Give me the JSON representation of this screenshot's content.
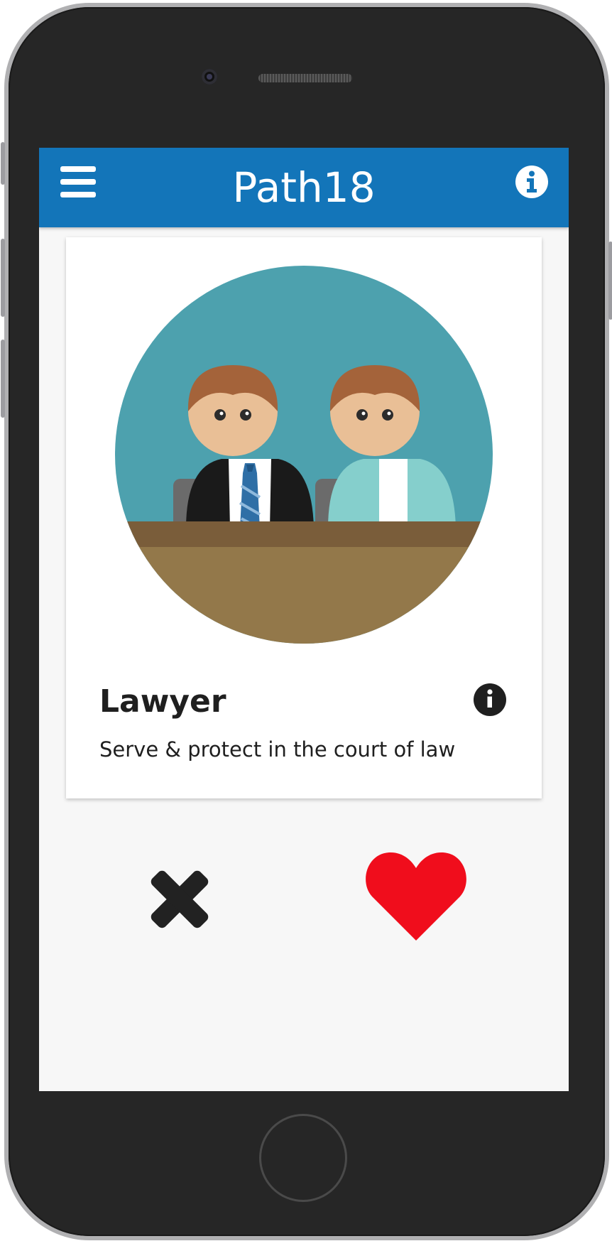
{
  "app": {
    "title": "Path18"
  },
  "card": {
    "title": "Lawyer",
    "description": "Serve & protect in the court of law",
    "image": "two-lawyers-at-desk-illustration"
  },
  "icons": {
    "menu": "hamburger-menu-icon",
    "app_info": "info-circle-icon",
    "job_info": "info-circle-icon",
    "reject": "close-x-icon",
    "like": "heart-icon"
  },
  "colors": {
    "app_bar": "#1375b9",
    "like": "#f00d1c",
    "reject": "#222222",
    "illustration_bg": "#4da1ae"
  }
}
